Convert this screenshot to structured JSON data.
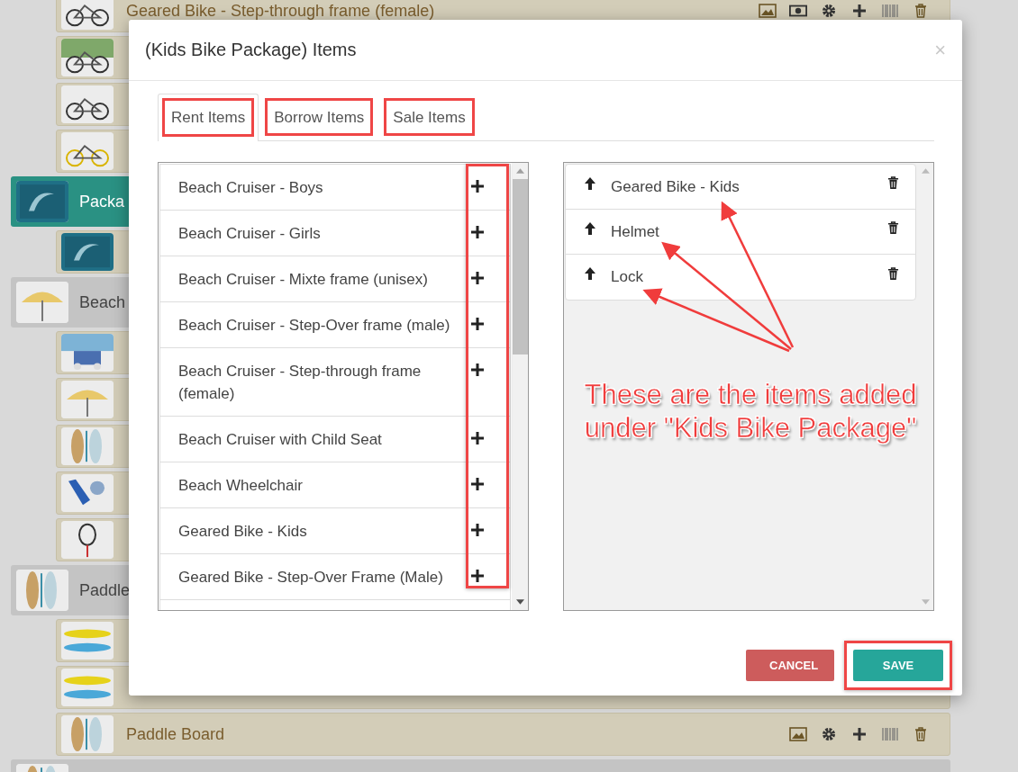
{
  "background_list": {
    "rows": [
      {
        "kind": "child",
        "label": "Geared Bike - Step-through frame (female)",
        "selected": false,
        "toolbar": true,
        "price_button": true
      },
      {
        "kind": "child",
        "selected": false
      },
      {
        "kind": "child",
        "selected": false
      },
      {
        "kind": "child",
        "selected": false
      },
      {
        "kind": "parent",
        "label": "Packa",
        "selected": true
      },
      {
        "kind": "child",
        "selected": false
      },
      {
        "kind": "parent",
        "label": "Beach",
        "selected": false
      },
      {
        "kind": "child",
        "selected": false
      },
      {
        "kind": "child",
        "selected": false
      },
      {
        "kind": "child",
        "selected": false
      },
      {
        "kind": "child",
        "selected": false
      },
      {
        "kind": "child",
        "selected": false
      },
      {
        "kind": "parent",
        "label": "Paddle",
        "selected": false
      },
      {
        "kind": "child",
        "selected": false
      },
      {
        "kind": "child",
        "selected": false
      },
      {
        "kind": "child",
        "label": "Paddle Board",
        "selected": false,
        "toolbar": true,
        "price_button": false
      },
      {
        "kind": "parent",
        "selected": false
      }
    ]
  },
  "dialog": {
    "title": "(Kids Bike Package) Items",
    "close": "×",
    "tabs": [
      {
        "label": "Rent Items",
        "selected": true,
        "highlighted": true
      },
      {
        "label": "Borrow Items",
        "selected": false,
        "highlighted": true
      },
      {
        "label": "Sale Items",
        "selected": false,
        "highlighted": true
      }
    ],
    "available_items": {
      "add_column_highlighted": true,
      "items": [
        {
          "label": "Beach Cruiser - Boys"
        },
        {
          "label": "Beach Cruiser - Girls"
        },
        {
          "label": "Beach Cruiser - Mixte frame (unisex)"
        },
        {
          "label": "Beach Cruiser - Step-Over frame (male)"
        },
        {
          "label": "Beach Cruiser - Step-through frame (female)"
        },
        {
          "label": "Beach Cruiser with Child Seat"
        },
        {
          "label": "Beach Wheelchair"
        },
        {
          "label": "Geared Bike - Kids"
        },
        {
          "label": "Geared Bike - Step-Over Frame (Male)"
        }
      ]
    },
    "package_items": [
      {
        "label": "Geared Bike - Kids"
      },
      {
        "label": "Helmet"
      },
      {
        "label": "Lock"
      }
    ],
    "callout": "These are the items added under \"Kids Bike Package\"",
    "buttons": [
      {
        "kind": "cancel",
        "label": "CANCEL",
        "highlighted": false
      },
      {
        "kind": "save",
        "label": "SAVE",
        "highlighted": true
      }
    ]
  }
}
